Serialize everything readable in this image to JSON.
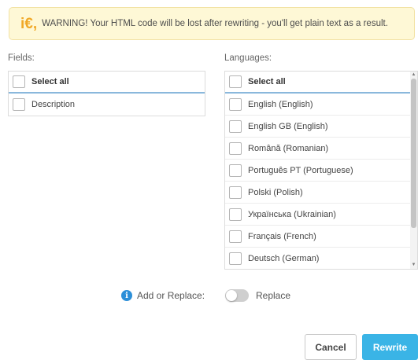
{
  "warning": {
    "icon": "euro-icon",
    "icon_glyph": "i€,",
    "text": "WARNING! Your HTML code will be lost after rewriting - you'll get plain text as a result."
  },
  "fields": {
    "label": "Fields:",
    "select_all": "Select all",
    "items": [
      "Description"
    ]
  },
  "languages": {
    "label": "Languages:",
    "select_all": "Select all",
    "items": [
      "English (English)",
      "English GB (English)",
      "Română (Romanian)",
      "Português PT (Portuguese)",
      "Polski (Polish)",
      "Українська (Ukrainian)",
      "Français (French)",
      "Deutsch (German)"
    ]
  },
  "mode": {
    "label": "Add or Replace:",
    "toggle_label": "Replace",
    "toggle_on": false
  },
  "buttons": {
    "cancel": "Cancel",
    "rewrite": "Rewrite"
  },
  "colors": {
    "accent": "#3ab4e6",
    "info": "#2d8fd8",
    "warning_bg": "#fef8d6",
    "warning_icon": "#f0a826"
  }
}
